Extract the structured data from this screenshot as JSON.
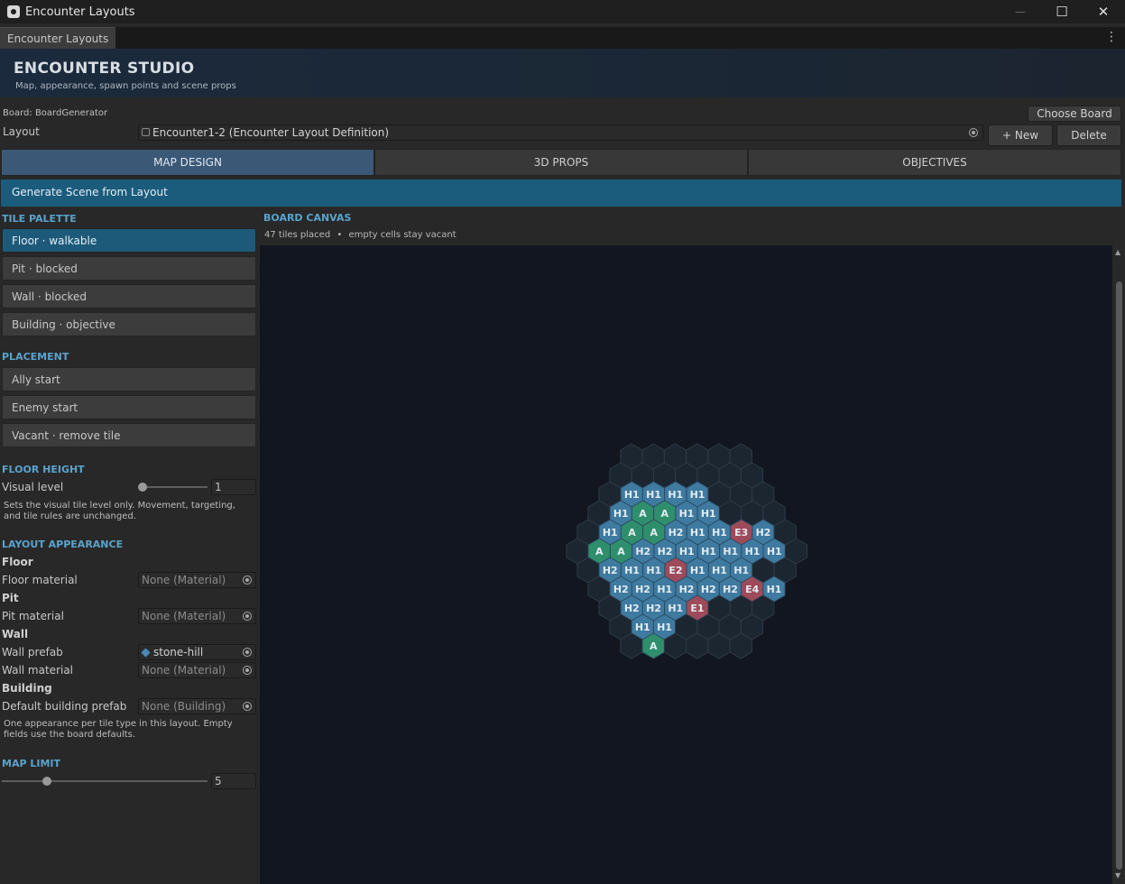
{
  "window": {
    "title": "Encounter Layouts",
    "minimize_glyph": "—",
    "maximize_glyph": "☐",
    "close_glyph": "✕"
  },
  "tab": {
    "label": "Encounter Layouts",
    "menu_glyph": "⋮"
  },
  "header": {
    "title": "ENCOUNTER STUDIO",
    "subtitle": "Map, appearance, spawn points and scene props"
  },
  "board": {
    "label": "Board: BoardGenerator",
    "choose_button": "Choose Board",
    "layout_label": "Layout",
    "layout_value": "Encounter1-2 (Encounter Layout Definition)",
    "new_button": "+ New",
    "delete_button": "Delete"
  },
  "main_tabs": [
    {
      "label": "MAP DESIGN",
      "active": true
    },
    {
      "label": "3D PROPS",
      "active": false
    },
    {
      "label": "OBJECTIVES",
      "active": false
    }
  ],
  "generate_button": "Generate Scene from Layout",
  "tile_palette": {
    "heading": "TILE PALETTE",
    "items": [
      {
        "label": "Floor · walkable",
        "active": true
      },
      {
        "label": "Pit · blocked",
        "active": false
      },
      {
        "label": "Wall · blocked",
        "active": false
      },
      {
        "label": "Building · objective",
        "active": false
      }
    ]
  },
  "placement": {
    "heading": "PLACEMENT",
    "items": [
      {
        "label": "Ally start"
      },
      {
        "label": "Enemy start"
      },
      {
        "label": "Vacant · remove tile"
      }
    ]
  },
  "floor_height": {
    "heading": "FLOOR HEIGHT",
    "label": "Visual level",
    "value": "1",
    "slider_fraction": 0,
    "help": "Sets the visual tile level only. Movement, targeting, and tile rules are unchanged."
  },
  "appearance": {
    "heading": "LAYOUT APPEARANCE",
    "floor_group": "Floor",
    "floor_material_label": "Floor material",
    "floor_material_value": "None (Material)",
    "pit_group": "Pit",
    "pit_material_label": "Pit material",
    "pit_material_value": "None (Material)",
    "wall_group": "Wall",
    "wall_prefab_label": "Wall prefab",
    "wall_prefab_value": "stone-hill",
    "wall_material_label": "Wall material",
    "wall_material_value": "None (Material)",
    "building_group": "Building",
    "building_prefab_label": "Default building prefab",
    "building_prefab_value": "None (Building)",
    "help": "One appearance per tile type in this layout. Empty fields use the board defaults."
  },
  "map_limit": {
    "heading": "MAP LIMIT",
    "value": "5",
    "slider_fraction": 0.22
  },
  "canvas": {
    "heading": "BOARD CANVAS",
    "count_text": "47 tiles placed",
    "separator": "•",
    "hint_text": "empty cells stay vacant",
    "colors": {
      "background": "#121620",
      "empty": "#1c2631",
      "empty_stroke": "#2e3b48",
      "floor": "#3f7aa0",
      "ally": "#2f8f6c",
      "enemy": "#9e4a5a",
      "label": "#e3ecf2"
    },
    "rows": [
      [
        "",
        "",
        "",
        "",
        "",
        ""
      ],
      [
        "",
        "",
        "",
        "",
        "",
        "",
        ""
      ],
      [
        "",
        "H1",
        "H1",
        "H1",
        "H1",
        "",
        "",
        ""
      ],
      [
        "",
        "H1",
        "A",
        "A",
        "H1",
        "H1",
        "",
        "",
        ""
      ],
      [
        "",
        "H1",
        "A",
        "A",
        "H2",
        "H1",
        "H1",
        "E3",
        "H2",
        ""
      ],
      [
        "",
        "A",
        "A",
        "H2",
        "H2",
        "H1",
        "H1",
        "H1",
        "H1",
        "H1",
        ""
      ],
      [
        "",
        "H2",
        "H1",
        "H1",
        "E2",
        "H1",
        "H1",
        "H1",
        "",
        ""
      ],
      [
        "",
        "H2",
        "H2",
        "H1",
        "H2",
        "H2",
        "H2",
        "E4",
        "H1"
      ],
      [
        "",
        "H2",
        "H2",
        "H1",
        "E1",
        "",
        "",
        ""
      ],
      [
        "",
        "H1",
        "H1",
        "",
        "",
        "",
        ""
      ],
      [
        "",
        "A",
        "",
        "",
        "",
        ""
      ]
    ]
  }
}
